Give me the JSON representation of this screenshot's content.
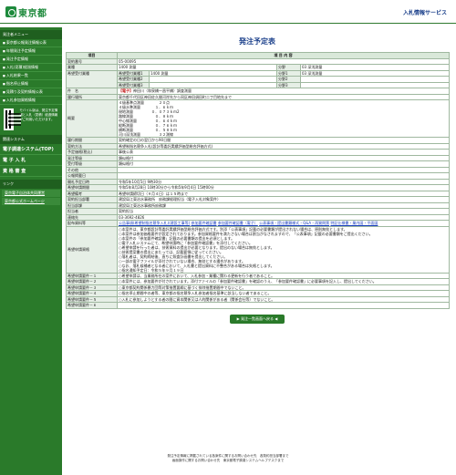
{
  "header": {
    "logo_text": "東京都",
    "system_name": "入札情報サービス"
  },
  "sidebar": {
    "menu_head": "発注者メニュー",
    "items": [
      "東京都公報発注情報公表",
      "年間発注予定情報",
      "発注予定情報",
      "入札(見積)経過情報",
      "入札結果一覧",
      "指名停止情報",
      "見積り及契約情報公表",
      "入札参加資格情報"
    ],
    "qr_note": "モバイル版は、発注予定情報と入札（見積）経過情報がご利用いただけます。",
    "system_head": "関連システム",
    "big_items": [
      "電子調達システム(TOP)",
      "電 子 入 札",
      "資 格 審 査"
    ],
    "links_head": "リンク",
    "links": [
      "東京電子自治体共同運営",
      "東京都公式ホームページ"
    ]
  },
  "main": {
    "title": "発注予定表",
    "table_head": {
      "item": "項目",
      "content": "項 目 内 容"
    },
    "rows": {
      "contract_no": {
        "label": "契約番号",
        "value": "05-00095"
      },
      "industry": {
        "label": "業種",
        "value": "1400 測量",
        "bunya_label": "分野",
        "bunya_value": "03 深浅測量"
      },
      "desired": {
        "label": "希望受付業種",
        "sub1": "希望受付業種1",
        "sub1_val": "1400 測量",
        "b1": "分野1",
        "b1v": "03 深浅測量",
        "sub2": "希望受付業種2",
        "sub2_val": "",
        "b2": "分野2",
        "b2v": "",
        "sub3": "希望受付業種3",
        "sub3_val": "",
        "b3": "分野3",
        "b3v": ""
      },
      "subject": {
        "label": "件　名",
        "tag": "【電子】",
        "value": "神田川（和泉橋〜昌平橋）調査測量"
      },
      "location": {
        "label": "履行場所",
        "value": "東京都千代田区神田佐久間河岸先から同区神田須田町二丁目地先まで"
      },
      "summary": {
        "label": "概要",
        "lines": [
          "４級基準点測量　　　　２０点",
          "４級水準測量　　　　１．６ｋｍ",
          "現地測量　　　　　０．０７３ｋｍ2",
          "路線測量　　　　　　０．８ｋｍ",
          "中心線測量　　　　　０．６４ｋｍ",
          "縦断測量　　　　　　０．７６ｋｍ",
          "横断測量　　　　　　０．５８ｋｍ",
          "河川深浅測量　　　　　３２測線"
        ]
      },
      "period": {
        "label": "履行期間",
        "value": "契約確定の日の翌日から90日間"
      },
      "method": {
        "label": "契約方法",
        "value": "希望制指名競争入札(設計等委託実績評価型総合評価方式)"
      },
      "price": {
        "label": "予定価格(税込)",
        "value": "事後公表"
      },
      "org": {
        "label": "発注等級",
        "value": "類似格付"
      },
      "grade": {
        "label": "受付等級",
        "value": "類似格付"
      },
      "other": {
        "label": "その他",
        "value": ""
      },
      "pub_date": {
        "label": "公報掲載日",
        "value": ""
      },
      "open_date": {
        "label": "開札予定日時",
        "value": "令和5年10月5日 9時30分"
      },
      "apply_period": {
        "label": "希望申請期間",
        "value": "令和5年8月28日 10時30分から令和5年9月4日 15時00分"
      },
      "apply_note": {
        "label": "希望備考",
        "value": "希望申請締切日（９月４日）は１５時まで"
      },
      "dept": {
        "label": "契約担当部署",
        "value": "建設局江東治水事務所　庶務課経理担当（電子入札対象案件）"
      },
      "charge": {
        "label": "担当部課",
        "value": "建設局江東治水事務所庶務課"
      },
      "person": {
        "label": "担当者",
        "value": "契約担当"
      },
      "tel": {
        "label": "連絡先",
        "value": "03-3692-4826"
      },
      "docs": {
        "label": "配布資料等",
        "links": [
          "公告事項(希望制指名競争入札)(建設工事等)",
          "参加要件確認書",
          "参加要件確認書（電子）",
          "公表事項・提出書類様式・Q&A・再質問票",
          "特記仕様書・業内図・平面図"
        ]
      },
      "qualification": {
        "label": "希望申請資格",
        "lines": [
          "○本案件は、東京都設計等委託実績評価型総合評価方式です。別添「公表事項」記載の必要書類が提出されない場合は、原則無効とします。",
          "○本案件は参加価格要件が設定されております。参加資格要件を満たさない場合は割当がなされますので、「公表事項」記載の必要書類をご提出ください。",
          "○本案件の「参加要件確認書」記載の必要書類の提出を必須とします。",
          "○電子入札システムにて、希望申請時に「参加要件確認書」を添付してください。",
          "○希望申請を行った者は、技術資料の提出が必要となります。提出のない場合は無効とします。",
          "○技術提案書の提出にあたっては、記載要領に従ってください。",
          "○落札者は、契約締結後、直ちに照査計画書を提出してください。",
          "○一部の電子ファイルが添付されていない場合、無効とする場合があります。",
          "○なお、落札候補者となる者において、入札書と提出資料に不整合がある場合は失格とします。",
          "○指名通知予定日：令和５年９月１９日"
        ]
      },
      "cond1": {
        "label": "希望申請要件－１",
        "value": "○希望申請は、当業務所在の案件において、入札参加・業種に関わる更新を行う者であること。"
      },
      "cond2": {
        "label": "希望申請要件－２",
        "value": "○本案件には、参加要件が付されています。添付ファイルの「参加要件確認書」を確認のうえ、「参加要件確認書」に必要事項を記入し、提出してください。"
      },
      "cond3": {
        "label": "希望申請要件－３",
        "value": "○東京都契約関係暴力団等対策措置要綱に基づく排除措置期間中でないこと。"
      },
      "cond4": {
        "label": "希望申請要件－４",
        "value": "○指名停止期間中の者等、東京都の指名競争入札参加者指名基準に該当しない者であること。"
      },
      "cond5": {
        "label": "希望申請要件－５",
        "value": "○入札に参加しようとする者の間に資本関係又は人的関係がある者（関係会社等）でないこと。"
      },
      "cond6": {
        "label": "希望申請要件－６",
        "value": ""
      }
    },
    "back_button": "▶ 発注一覧画面へ戻る ◀"
  },
  "footer": {
    "line1": "発注予定情報に掲載されている各案件に関するお問い合わせ先　各契約担当部署まで",
    "line2": "画面操作に関するお問い合わせ先　東京都電子調達システムヘルプデスクまで"
  }
}
